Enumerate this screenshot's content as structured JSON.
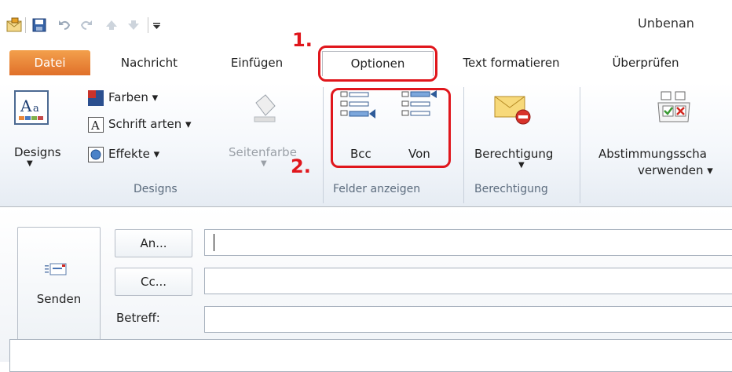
{
  "window": {
    "title": "Unbenan"
  },
  "tabs": [
    {
      "label": "Datei",
      "key": "file"
    },
    {
      "label": "Nachricht",
      "key": "message"
    },
    {
      "label": "Einfügen",
      "key": "insert"
    },
    {
      "label": "Optionen",
      "key": "options",
      "active": true
    },
    {
      "label": "Text formatieren",
      "key": "format-text"
    },
    {
      "label": "Überprüfen",
      "key": "review"
    }
  ],
  "ribbon": {
    "designs": {
      "designs_label": "Designs",
      "colors_label": "Farben ▾",
      "fonts_label": "Schrift arten ▾",
      "effects_label": "Effekte ▾",
      "page_color_label": "Seitenfarbe",
      "group_label": "Designs"
    },
    "show_fields": {
      "bcc_label": "Bcc",
      "from_label": "Von",
      "group_label": "Felder anzeigen"
    },
    "permission": {
      "permission_label": "Berechtigung",
      "group_label": "Berechtigung"
    },
    "voting": {
      "line1": "Abstimmungsscha",
      "line2": "verwenden ▾"
    }
  },
  "compose": {
    "send_label": "Senden",
    "to_label": "An...",
    "cc_label": "Cc...",
    "subject_label": "Betreff:",
    "to_value": "",
    "cc_value": "",
    "subject_value": ""
  },
  "annotations": {
    "step1": "1.",
    "step2": "2."
  },
  "colors": {
    "file_tab": "#e0702a",
    "annotation": "#e0161c",
    "ribbon_text": "#1e395b"
  }
}
